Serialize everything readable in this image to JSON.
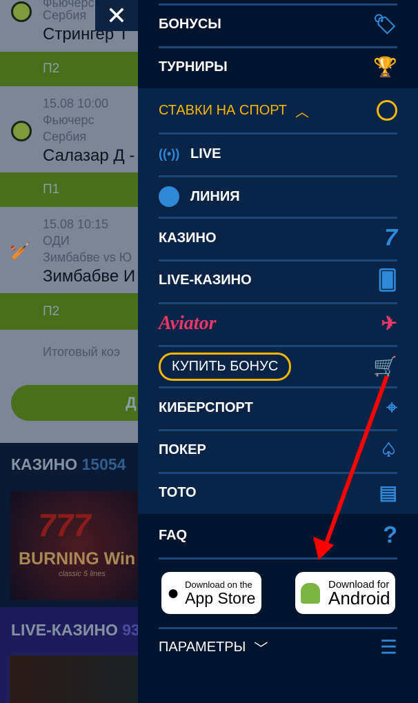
{
  "background": {
    "match1": {
      "name": "Стрингер Т",
      "sub": "Сербия",
      "top": "Фьючерс",
      "bet": "П2"
    },
    "match2": {
      "date": "15.08 10:00",
      "league": "Фьючерс",
      "sub": "Сербия",
      "name": "Салазар Д -",
      "bet": "П1"
    },
    "match3": {
      "date": "15.08 10:15",
      "league": "ОДИ",
      "sub": "Зимбабве vs Ю",
      "name": "Зимбабве И",
      "bet": "П2"
    },
    "total_label": "Итоговый коэ",
    "pill_label": "Д",
    "casino": {
      "label": "КАЗИНО",
      "count": "15054",
      "game_title": "BURNING Win",
      "game_sub": "classic 5 lines",
      "game_num": "777"
    },
    "live_casino": {
      "label": "LIVE-КАЗИНО",
      "count": "93"
    }
  },
  "close_icon": "✕",
  "menu": {
    "items": [
      {
        "label": "БОНУСЫ",
        "icon": "tag-icon"
      },
      {
        "label": "ТУРНИРЫ",
        "icon": "trophy-icon"
      },
      {
        "label": "СТАВКИ НА СПОРТ",
        "icon": "basketball-icon",
        "accent": "#f5b800"
      },
      {
        "label": "LIVE",
        "icon": "broadcast-icon"
      },
      {
        "label": "ЛИНИЯ",
        "icon": "soccer-ball-icon"
      },
      {
        "label": "КАЗИНО",
        "icon": "seven-icon"
      },
      {
        "label": "LIVE-КАЗИНО",
        "icon": "cards-icon"
      },
      {
        "label": "Aviator",
        "icon": "plane-icon"
      },
      {
        "label": "КУПИТЬ БОНУС",
        "icon": "cart-star-icon"
      },
      {
        "label": "КИБЕРСПОРТ",
        "icon": "crosshair-icon"
      },
      {
        "label": "ПОКЕР",
        "icon": "poker-suits-icon"
      },
      {
        "label": "ТОТО",
        "icon": "toto-icon"
      },
      {
        "label": "FAQ",
        "icon": "question-icon"
      }
    ],
    "app_store": {
      "line1": "Download on the",
      "line2": "App Store"
    },
    "android": {
      "line1": "Download for",
      "line2": "Android"
    },
    "params": "ПАРАМЕТРЫ"
  },
  "colors": {
    "accent": "#f5b800",
    "icon": "#2f88d8",
    "aviator": "#e8386a",
    "arrow": "#ff0000"
  }
}
